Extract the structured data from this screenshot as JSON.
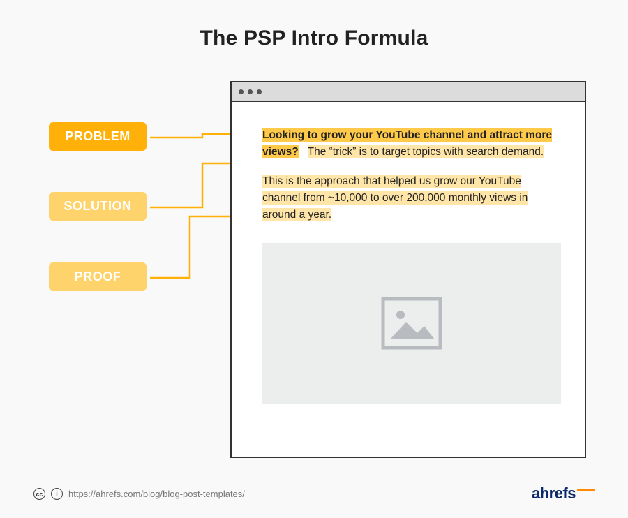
{
  "title": "The PSP Intro Formula",
  "labels": {
    "problem": "PROBLEM",
    "solution": "SOLUTION",
    "proof": "PROOF"
  },
  "paragraph1": {
    "problem_text": "Looking to grow your YouTube channel and attract more views?",
    "solution_text": "The “trick” is to target topics with search demand."
  },
  "paragraph2": {
    "proof_text": "This is the approach that helped us grow our YouTube channel from ~10,000 to over 200,000 monthly views in around a year."
  },
  "footer": {
    "url": "https://ahrefs.com/blog/blog-post-templates/",
    "cc": "cc",
    "by": "i"
  },
  "brand": "ahrefs",
  "colors": {
    "label_primary": "#ffb109",
    "label_secondary": "#ffd36b",
    "highlight_strong": "#ffc94a",
    "highlight_light": "#ffe6a8",
    "brand_blue": "#0b2a6b",
    "brand_orange": "#ff8a00"
  }
}
